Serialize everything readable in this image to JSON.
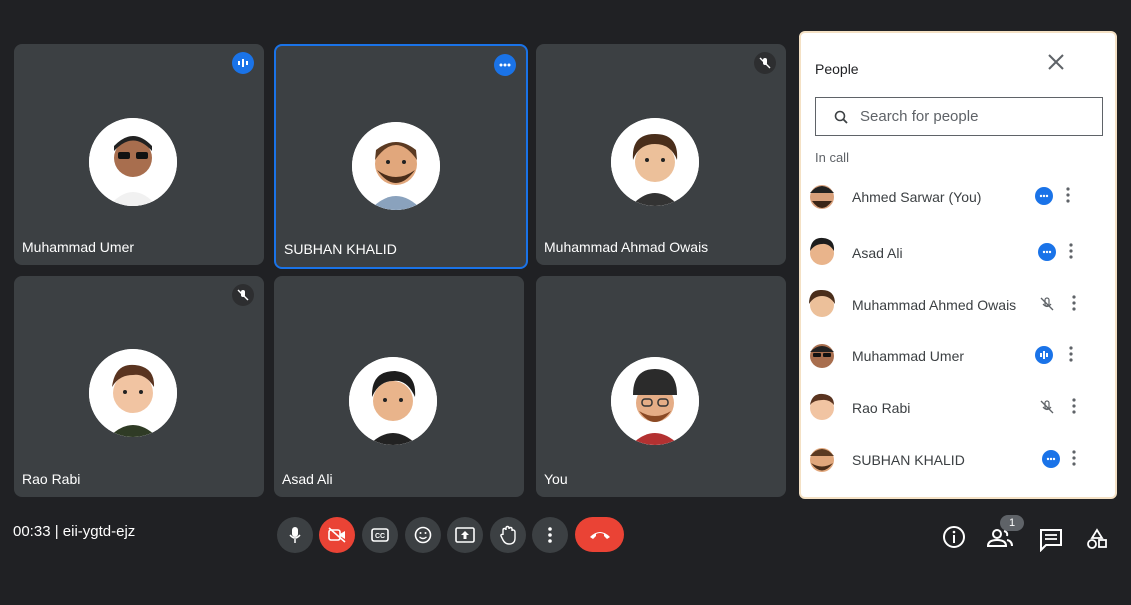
{
  "tiles": [
    {
      "name": "Muhammad Umer"
    },
    {
      "name": "SUBHAN KHALID"
    },
    {
      "name": "Muhammad Ahmad Owais"
    },
    {
      "name": "Rao Rabi"
    },
    {
      "name": "Asad Ali"
    },
    {
      "name": "You"
    }
  ],
  "panel": {
    "title": "People",
    "search_placeholder": "Search for people",
    "section_label": "In call",
    "people": [
      {
        "name": "Ahmed Sarwar (You)",
        "status": "more"
      },
      {
        "name": "Asad Ali",
        "status": "more"
      },
      {
        "name": "Muhammad Ahmed Owais",
        "status": "muted"
      },
      {
        "name": "Muhammad Umer",
        "status": "speaking"
      },
      {
        "name": "Rao Rabi",
        "status": "muted"
      },
      {
        "name": "SUBHAN KHALID",
        "status": "more"
      }
    ]
  },
  "meeting_info": "00:33 | eii-ygtd-ejz",
  "participant_count": "1",
  "colors": {
    "accent": "#1a73e8",
    "danger": "#ea4335",
    "tile": "#3c4043",
    "background": "#202124"
  },
  "icons": [
    "microphone-icon",
    "camera-off-icon",
    "captions-icon",
    "emoji-icon",
    "present-screen-icon",
    "raise-hand-icon",
    "more-options-icon",
    "hang-up-icon",
    "info-icon",
    "people-icon",
    "chat-icon",
    "activities-icon"
  ]
}
